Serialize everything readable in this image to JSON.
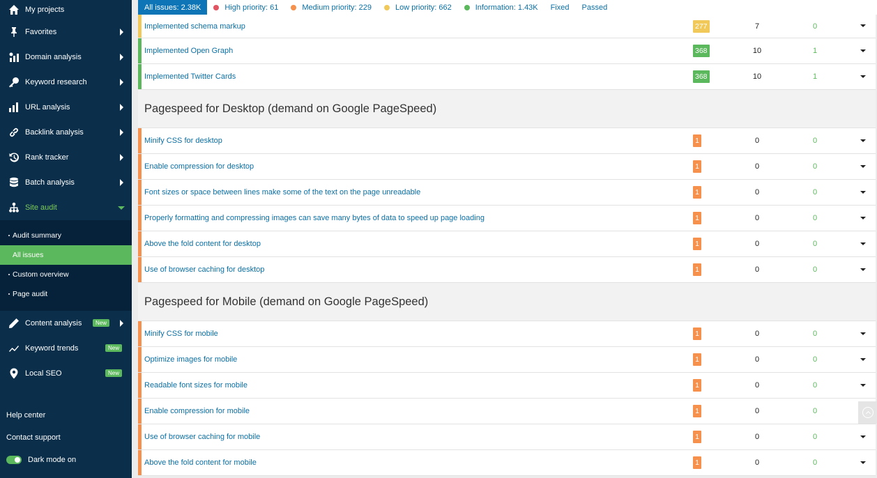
{
  "colors": {
    "sidebar_bg": "#0b2f4b",
    "accent_green": "#5cb85c",
    "link_blue": "#0b6fa4",
    "tab_active": "#0e75b6",
    "high": "#e05561",
    "medium": "#f5914c",
    "low": "#f1c95b",
    "info": "#5cb85c"
  },
  "sidebar": {
    "items": [
      {
        "label": "My projects",
        "icon": "home-icon"
      },
      {
        "label": "Favorites",
        "icon": "pin-icon"
      },
      {
        "label": "Domain analysis",
        "icon": "domain-analysis-icon"
      },
      {
        "label": "Keyword research",
        "icon": "key-icon"
      },
      {
        "label": "URL analysis",
        "icon": "bar-chart-icon"
      },
      {
        "label": "Backlink analysis",
        "icon": "link-icon"
      },
      {
        "label": "Rank tracker",
        "icon": "history-icon"
      },
      {
        "label": "Batch analysis",
        "icon": "database-icon"
      },
      {
        "label": "Site audit",
        "icon": "sitemap-icon"
      }
    ],
    "subitems": [
      "Audit summary",
      "All issues",
      "Custom overview",
      "Page audit"
    ],
    "items2": [
      {
        "label": "Content analysis",
        "icon": "pencil-icon",
        "badge": "New"
      },
      {
        "label": "Keyword trends",
        "icon": "trend-icon",
        "badge": "New"
      },
      {
        "label": "Local SEO",
        "icon": "location-icon",
        "badge": "New"
      }
    ],
    "bottom": {
      "help": "Help center",
      "support": "Contact support",
      "dark_mode": "Dark mode on"
    }
  },
  "tabs": {
    "all": "All issues: 2.38K",
    "high": "High priority: 61",
    "medium": "Medium priority: 229",
    "low": "Low priority: 662",
    "info": "Information: 1.43K",
    "fixed": "Fixed",
    "passed": "Passed"
  },
  "group1": [
    {
      "name": "Implemented schema markup",
      "count": "277",
      "pages": "7",
      "fixed": "0",
      "priority": "low"
    },
    {
      "name": "Implemented Open Graph",
      "count": "368",
      "pages": "10",
      "fixed": "1",
      "priority": "info"
    },
    {
      "name": "Implemented Twitter Cards",
      "count": "368",
      "pages": "10",
      "fixed": "1",
      "priority": "info"
    }
  ],
  "section_desktop": "Pagespeed for Desktop (demand on Google PageSpeed)",
  "desktop": [
    {
      "name": "Minify CSS for desktop",
      "count": "1",
      "pages": "0",
      "fixed": "0"
    },
    {
      "name": "Enable compression for desktop",
      "count": "1",
      "pages": "0",
      "fixed": "0"
    },
    {
      "name": "Font sizes or space between lines make some of the text on the page unreadable",
      "count": "1",
      "pages": "0",
      "fixed": "0"
    },
    {
      "name": "Properly formatting and compressing images can save many bytes of data to speed up page loading",
      "count": "1",
      "pages": "0",
      "fixed": "0"
    },
    {
      "name": "Above the fold content for desktop",
      "count": "1",
      "pages": "0",
      "fixed": "0"
    },
    {
      "name": "Use of browser caching for desktop",
      "count": "1",
      "pages": "0",
      "fixed": "0"
    }
  ],
  "section_mobile": "Pagespeed for Mobile (demand on Google PageSpeed)",
  "mobile": [
    {
      "name": "Minify CSS for mobile",
      "count": "1",
      "pages": "0",
      "fixed": "0"
    },
    {
      "name": "Optimize images for mobile",
      "count": "1",
      "pages": "0",
      "fixed": "0"
    },
    {
      "name": "Readable font sizes for mobile",
      "count": "1",
      "pages": "0",
      "fixed": "0"
    },
    {
      "name": "Enable compression for mobile",
      "count": "1",
      "pages": "0",
      "fixed": "0"
    },
    {
      "name": "Use of browser caching for mobile",
      "count": "1",
      "pages": "0",
      "fixed": "0"
    },
    {
      "name": "Above the fold content for mobile",
      "count": "1",
      "pages": "0",
      "fixed": "0"
    }
  ]
}
